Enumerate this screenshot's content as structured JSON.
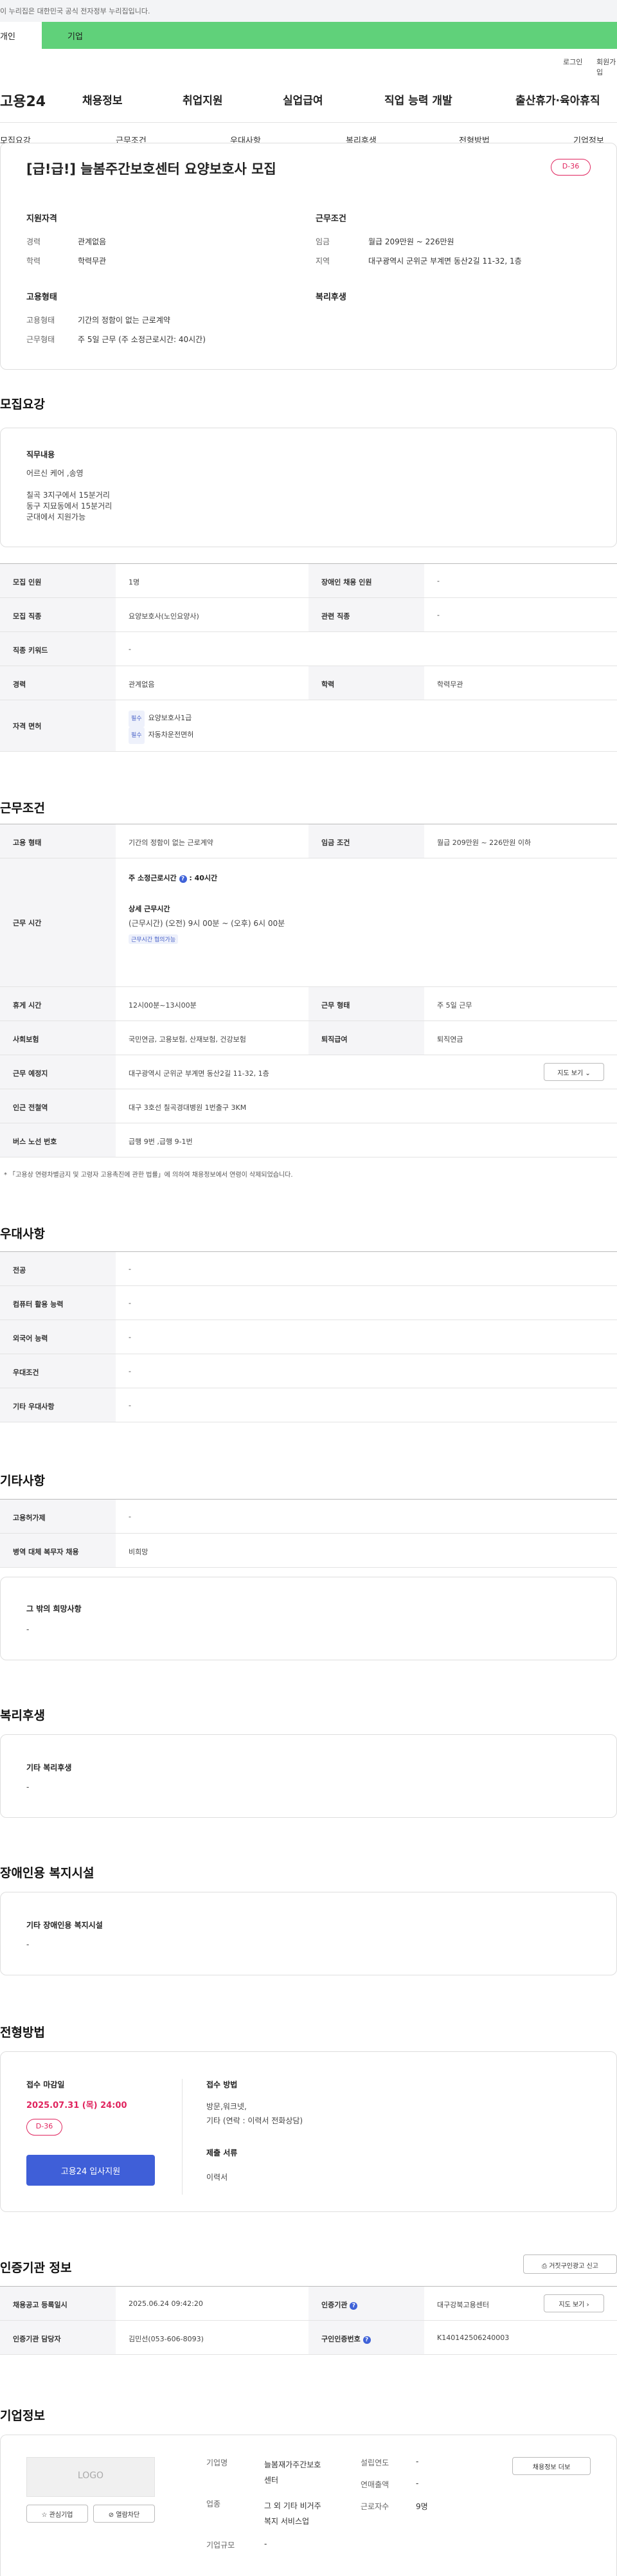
{
  "topbar": {
    "text": "이 누리집은 대한민국 공식 전자정부 누리집입니다."
  },
  "user_tabs": {
    "personal": "개인",
    "business": "기업"
  },
  "util": {
    "login": "로그인",
    "join": "회원가입"
  },
  "logo": "고용24",
  "gnb": [
    "채용정보",
    "취업지원",
    "실업급여",
    "직업 능력 개발",
    "출산휴가·육아휴직"
  ],
  "subnav": [
    "모집요강",
    "근무조건",
    "우대사항",
    "복리후생",
    "전형방법",
    "기업정보"
  ],
  "summary": {
    "title": "[급!급!] 늘봄주간보호센터 요양보호사 모집",
    "dday": "D-36",
    "qual_title": "지원자격",
    "career_label": "경력",
    "career_value": "관계없음",
    "edu_label": "학력",
    "edu_value": "학력무관",
    "work_title": "근무조건",
    "wage_label": "임금",
    "wage_value": "월급 209만원 ~ 226만원",
    "region_label": "지역",
    "region_value": "대구광역시 군위군 부계면 동산2길 11-32, 1층",
    "emp_title": "고용형태",
    "emptype_label": "고용형태",
    "emptype_value": "기간의 정함이 없는 근로계약",
    "worktype_label": "근무형태",
    "worktype_value": "주 5일 근무 (주 소정근로시간: 40시간)",
    "welfare_title": "복리후생"
  },
  "recruit": {
    "heading": "모집요강",
    "job_title": "직무내용",
    "job_lines": [
      "어르신 케어 ,송영",
      "",
      "칠곡 3지구에서 15분거리",
      "동구 지묘동에서 15분거리",
      "군대에서 지원가능"
    ],
    "rows": [
      {
        "l1": "모집 인원",
        "v1": "1명",
        "l2": "장애인 채용 인원",
        "v2": "-"
      },
      {
        "l1": "모집 직종",
        "v1": "요양보호사(노인요양사)",
        "l2": "관련 직종",
        "v2": "-"
      },
      {
        "l1": "직종 키워드",
        "v1": "-"
      },
      {
        "l1": "경력",
        "v1": "관계없음",
        "l2": "학력",
        "v2": "학력무관"
      }
    ],
    "license_label": "자격 면허",
    "licenses": [
      {
        "tag": "필수",
        "name": "요양보호사1급"
      },
      {
        "tag": "필수",
        "name": "자동차운전면허"
      }
    ]
  },
  "conditions": {
    "heading": "근무조건",
    "emptype_label": "고용 형태",
    "emptype_value": "기간의 정함이 없는 근로계약",
    "wage_label": "임금 조건",
    "wage_value": "월급 209만원 ~ 226만원 이하",
    "hours_label": "근무 시간",
    "hours_main": "주 소정근로시간",
    "hours_main_value": ": 40시간",
    "hours_detail_title": "상세 근무시간",
    "hours_detail": "(근무시간) (오전) 9시 00분 ~ (오후) 6시 00분",
    "hours_tag": "근무시간 협의가능",
    "rest_label": "휴게 시간",
    "rest_value": "12시00분~13시00분",
    "shift_label": "근무 형태",
    "shift_value": "주 5일 근무",
    "insurance_label": "사회보험",
    "insurance_value": "국민연금, 고용보험, 산재보험, 건강보험",
    "severance_label": "퇴직급여",
    "severance_value": "퇴직연금",
    "place_label": "근무 예정지",
    "place_value": "대구광역시 군위군 부계면 동산2길 11-32, 1층",
    "map_btn": "지도 보기",
    "subway_label": "인근 전철역",
    "subway_value": "대구 3호선 칠곡경대병원 1번출구 3KM",
    "bus_label": "버스 노선 번호",
    "bus_value": "급행 9번 ,급행 9-1번",
    "note": "* 「고용상 연령차별금지 및 고령자 고용촉진에 관한 법률」에 의하여 채용정보에서 연령이 삭제되었습니다."
  },
  "preference": {
    "heading": "우대사항",
    "rows": [
      {
        "l": "전공",
        "v": "-"
      },
      {
        "l": "컴퓨터 활용 능력",
        "v": "-"
      },
      {
        "l": "외국어 능력",
        "v": "-"
      },
      {
        "l": "우대조건",
        "v": "-"
      },
      {
        "l": "기타 우대사항",
        "v": "-"
      }
    ]
  },
  "etc": {
    "heading": "기타사항",
    "rows": [
      {
        "l": "고용허가제",
        "v": "-"
      },
      {
        "l": "병역 대체 복무자 채용",
        "v": "비희망"
      }
    ],
    "other_title": "그 밖의 희망사항",
    "other_value": "-"
  },
  "welfare": {
    "heading": "복리후생",
    "box_title": "기타 복리후생",
    "box_value": "-"
  },
  "disabled": {
    "heading": "장애인용 복지시설",
    "box_title": "기타 장애인용 복지시설",
    "box_value": "-"
  },
  "selection": {
    "heading": "전형방법",
    "deadline_title": "접수 마감일",
    "deadline_value": "2025.07.31 (목) 24:00",
    "dday": "D-36",
    "apply_btn": "고용24 입사지원",
    "method_title": "접수 방법",
    "method_lines": [
      "방문,워크넷,",
      "기타 (연락 : 이력서  전화상담)"
    ],
    "docs_title": "제출 서류",
    "docs_value": "이력서"
  },
  "agency": {
    "heading": "인증기관 정보",
    "report_btn": "거짓구인광고 신고",
    "reg_label": "채용공고 등록일시",
    "reg_value": "2025.06.24 09:42:20",
    "org_label": "인증기관",
    "org_value": "대구강북고용센터",
    "map_btn": "지도 보기",
    "manager_label": "인증기관 담당자",
    "manager_value": "김민선(053-606-8093)",
    "num_label": "구인인증번호",
    "num_value": "K140142506240003"
  },
  "company": {
    "heading": "기업정보",
    "logo_text": "LOGO",
    "interest_btn": "관심기업",
    "block_btn": "열람차단",
    "name_label": "기업명",
    "name_value": [
      "늘봄재가주간보호",
      "센터"
    ],
    "year_label": "설립연도",
    "year_value": "-",
    "industry_label": "업종",
    "industry_value": [
      "그 외 기타 비거주",
      "복지 서비스업"
    ],
    "sales_label": "연매출액",
    "sales_value": "-",
    "workers_label": "근로자수",
    "workers_value": "9명",
    "size_label": "기업규모",
    "size_value": "-",
    "jobs_btn": "채용정보 더보"
  }
}
